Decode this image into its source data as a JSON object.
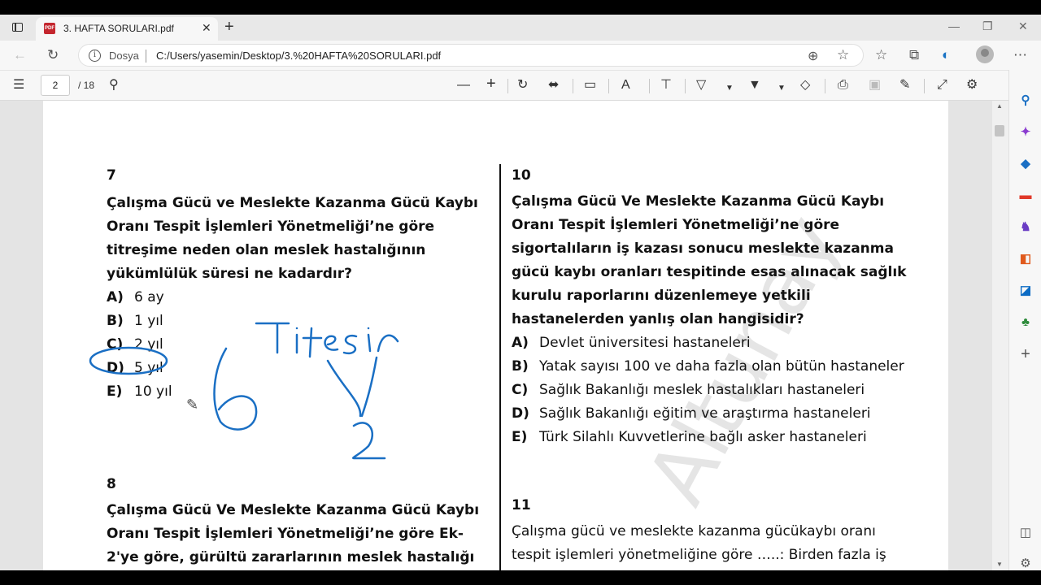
{
  "tab": {
    "title": "3. HAFTA SORULARI.pdf",
    "close": "✕",
    "new_tab": "+"
  },
  "window": {
    "minimize": "—",
    "restore": "❐",
    "close": "✕"
  },
  "address": {
    "label": "Dosya",
    "url": "C:/Users/yasemin/Desktop/3.%20HAFTA%20SORULARI.pdf"
  },
  "pdf_toolbar": {
    "page": "2",
    "total": "/ 18"
  },
  "questions": {
    "q7": {
      "number": "7",
      "text": "Çalışma Gücü ve Meslekte Kazanma Gücü Kaybı Oranı Tespit İşlemleri Yönetmeliği’ne göre titreşime neden olan meslek hastalığının yükümlülük süresi ne kadardır?",
      "options": [
        {
          "letter": "A)",
          "text": "6 ay"
        },
        {
          "letter": "B)",
          "text": "1 yıl"
        },
        {
          "letter": "C)",
          "text": "2 yıl"
        },
        {
          "letter": "D)",
          "text": "5 yıl"
        },
        {
          "letter": "E)",
          "text": "10 yıl"
        }
      ]
    },
    "q8": {
      "number": "8",
      "text": "Çalışma Gücü Ve Meslekte Kazanma Gücü Kaybı Oranı Tespit İşlemleri Yönetmeliği’ne göre Ek-2'ye göre, gürültü zararlarının meslek hastalığı sayılabilmesi için"
    },
    "q10": {
      "number": "10",
      "text": "Çalışma Gücü Ve Meslekte Kazanma Gücü Kaybı Oranı Tespit İşlemleri Yönetmeliği’ne göre sigortalıların iş kazası sonucu meslekte kazanma gücü kaybı oranları tespitinde esas alınacak sağlık kurulu raporlarını düzenlemeye yetkili hastanelerden yanlış olan hangisidir?",
      "options": [
        {
          "letter": "A)",
          "text": "Devlet üniversitesi hastaneleri"
        },
        {
          "letter": "B)",
          "text": "Yatak sayısı 100 ve daha fazla olan bütün hastaneler"
        },
        {
          "letter": "C)",
          "text": "Sağlık Bakanlığı meslek hastalıkları hastaneleri"
        },
        {
          "letter": "D)",
          "text": "Sağlık Bakanlığı eğitim ve araştırma hastaneleri"
        },
        {
          "letter": "E)",
          "text": "Türk Silahlı Kuvvetlerine bağlı asker hastaneleri"
        }
      ]
    },
    "q11": {
      "number": "11",
      "text": "Çalışma gücü ve meslekte kazanma gücükaybı oranı tespit işlemleri yönetmeliğine göre …..: Birden fazla iş"
    }
  },
  "annotation": {
    "handwriting": "Titreşim"
  },
  "watermark": "Altunay",
  "colors": {
    "ink": "#1a6fc4",
    "accent": "#c4262e"
  }
}
